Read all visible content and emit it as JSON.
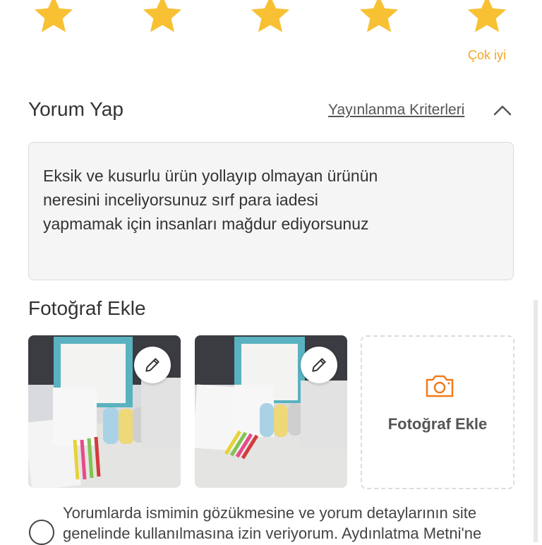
{
  "rating": {
    "stars": [
      {
        "name": "star-1",
        "filled": true
      },
      {
        "name": "star-2",
        "filled": true
      },
      {
        "name": "star-3",
        "filled": true
      },
      {
        "name": "star-4",
        "filled": true
      },
      {
        "name": "star-5",
        "filled": true
      }
    ],
    "selected_value": 5,
    "max_value": 5,
    "label": "Çok iyi",
    "star_color": "#f7c133",
    "label_color": "#f5a623"
  },
  "comment": {
    "title": "Yorum Yap",
    "criteria_link": "Yayınlanma Kriterleri",
    "text": "Eksik ve kusurlu ürün yollayıp olmayan ürünün\nneresini inceliyorsunuz sırf para iadesi\nyapmamak için insanları mağdur ediyorsunuz"
  },
  "photos": {
    "title": "Fotoğraf Ekle",
    "items": [
      {
        "icon": "pencil-icon",
        "alt": "photo-1"
      },
      {
        "icon": "pencil-icon",
        "alt": "photo-2"
      }
    ],
    "add_label": "Fotoğraf Ekle",
    "add_icon": "camera-icon",
    "accent_color": "#f27a1a"
  },
  "consent": {
    "text": "Yorumlarda ismimin gözükmesine ve yorum detaylarının site genelinde kullanılmasına izin veriyorum. Aydınlatma Metni'ne",
    "checked": false
  }
}
